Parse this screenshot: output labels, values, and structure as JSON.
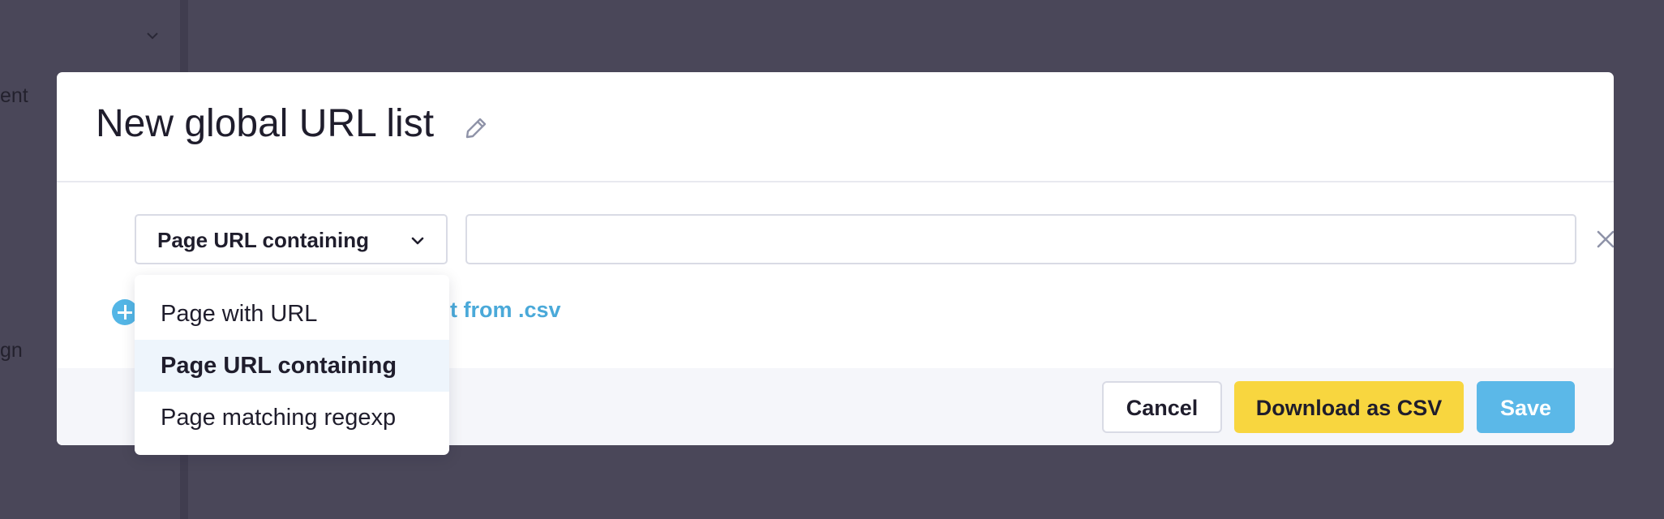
{
  "background": {
    "text_fragment_1": "ent",
    "text_fragment_2": "gn"
  },
  "modal": {
    "title": "New global URL list",
    "edit_icon": "pencil-icon",
    "rule": {
      "selected_type": "Page URL containing",
      "value": "",
      "remove_icon": "close-icon"
    },
    "add_link_visible_text": "t from .csv",
    "add_icon": "plus-circle-icon",
    "footer": {
      "cancel_label": "Cancel",
      "download_label": "Download as CSV",
      "save_label": "Save"
    }
  },
  "dropdown": {
    "options": [
      "Page with URL",
      "Page URL containing",
      "Page matching regexp"
    ],
    "selected_index": 1
  },
  "colors": {
    "overlay": "#4a4759",
    "accent_blue": "#5bb8e8",
    "accent_yellow": "#f8d63f",
    "text_dark": "#1f1d2c"
  }
}
